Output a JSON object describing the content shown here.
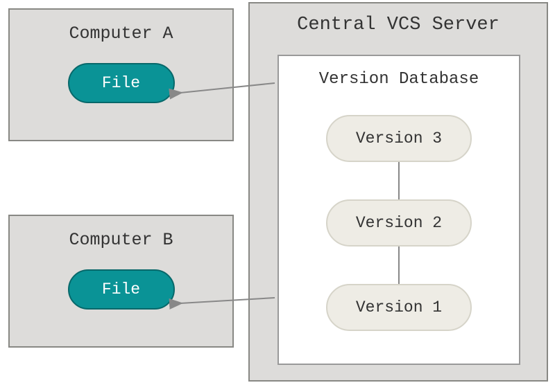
{
  "computerA": {
    "title": "Computer A",
    "file_label": "File"
  },
  "computerB": {
    "title": "Computer B",
    "file_label": "File"
  },
  "server": {
    "title": "Central VCS Server",
    "database": {
      "title": "Version Database",
      "versions": {
        "v3": "Version 3",
        "v2": "Version 2",
        "v1": "Version 1"
      }
    }
  },
  "colors": {
    "box_bg": "#dddcda",
    "file_pill": "#0a9396",
    "version_pill": "#eeece5"
  }
}
